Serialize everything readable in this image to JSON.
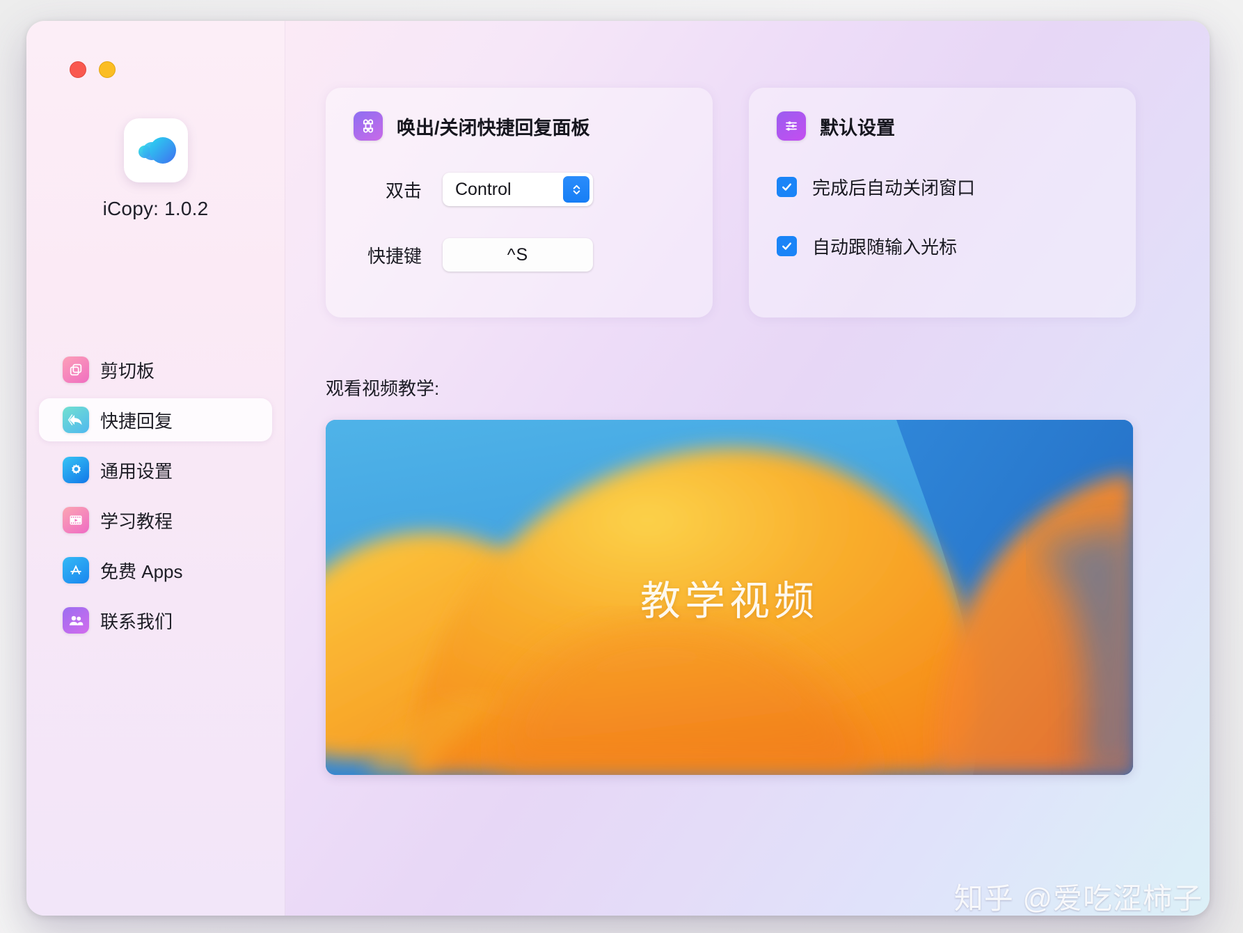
{
  "window": {
    "traffic_lights": [
      {
        "name": "close",
        "color": "#f9584f"
      },
      {
        "name": "minimize",
        "color": "#fbbd23"
      }
    ]
  },
  "sidebar": {
    "app_title": "iCopy: 1.0.2",
    "app_icon": "icopy-logo-icon",
    "items": [
      {
        "label": "剪切板",
        "icon": "clipboard-icon",
        "active": false,
        "grad_from": "#fca0b8",
        "grad_to": "#f06ec0"
      },
      {
        "label": "快捷回复",
        "icon": "reply-arrow-icon",
        "active": true,
        "grad_from": "#72e0d0",
        "grad_to": "#4fb8ef"
      },
      {
        "label": "通用设置",
        "icon": "gear-icon",
        "active": false,
        "grad_from": "#36c4f5",
        "grad_to": "#1277e8"
      },
      {
        "label": "学习教程",
        "icon": "video-film-icon",
        "active": false,
        "grad_from": "#fba6b2",
        "grad_to": "#ef6bc4"
      },
      {
        "label": "免费 Apps",
        "icon": "app-store-icon",
        "active": false,
        "grad_from": "#34b9f5",
        "grad_to": "#1a86ef"
      },
      {
        "label": "联系我们",
        "icon": "people-icon",
        "active": false,
        "grad_from": "#9b6ef0",
        "grad_to": "#d26bee"
      }
    ]
  },
  "main": {
    "shortcut_card": {
      "icon": "command-key-icon",
      "title": "唤出/关闭快捷回复面板",
      "double_click_label": "双击",
      "double_click_value": "Control",
      "hotkey_label": "快捷键",
      "hotkey_value": "^S"
    },
    "defaults_card": {
      "icon": "sliders-icon",
      "title": "默认设置",
      "options": [
        {
          "label": "完成后自动关闭窗口",
          "checked": true
        },
        {
          "label": "自动跟随输入光标",
          "checked": true
        }
      ]
    },
    "video": {
      "caption": "观看视频教学:",
      "overlay_text": "教学视频",
      "open_icon": "open-external-icon"
    }
  },
  "watermark": {
    "text": "知乎 @爱吃涩柿子"
  },
  "colors": {
    "accent_blue": "#1a84f7",
    "sidebar_bg": "#fbeaf5",
    "main_bg": "#e7d7f6"
  }
}
